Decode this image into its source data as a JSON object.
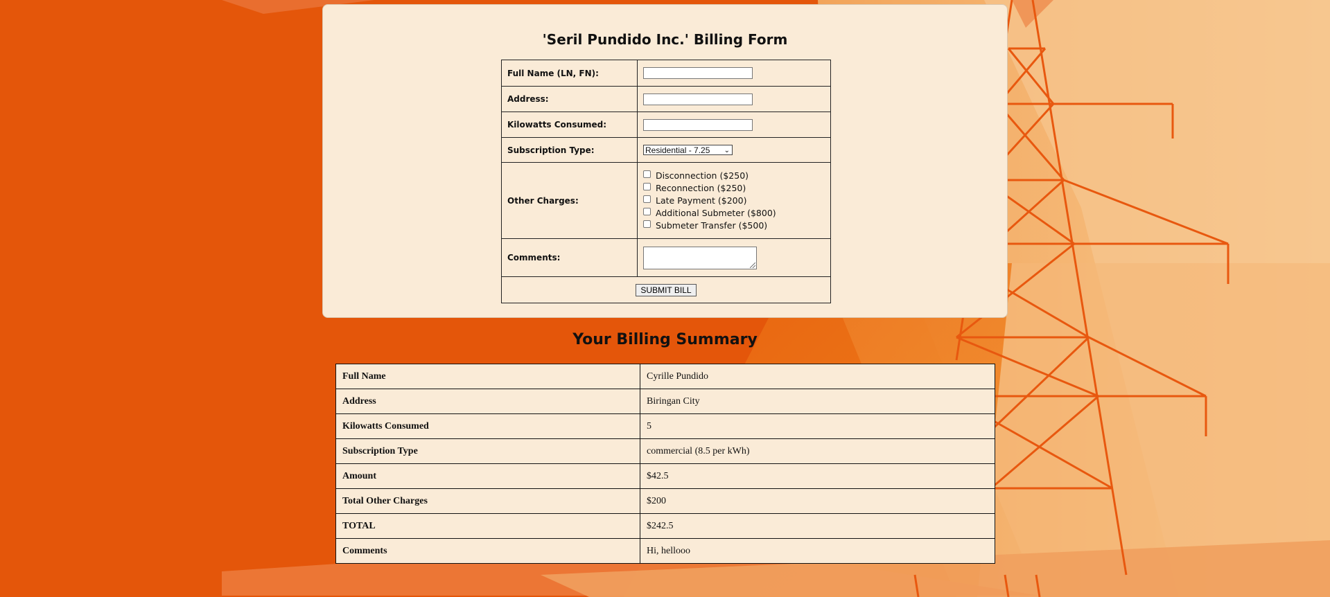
{
  "form": {
    "title": "'Seril Pundido Inc.' Billing Form",
    "full_name_label": "Full Name (LN, FN):",
    "full_name_value": "",
    "address_label": "Address:",
    "address_value": "",
    "kilowatts_label": "Kilowatts Consumed:",
    "kilowatts_value": "",
    "subscription_label": "Subscription Type:",
    "subscription_selected": "Residential - 7.25",
    "other_charges_label": "Other Charges:",
    "other_charges": [
      {
        "label": "Disconnection ($250)",
        "checked": false
      },
      {
        "label": "Reconnection ($250)",
        "checked": false
      },
      {
        "label": "Late Payment ($200)",
        "checked": false
      },
      {
        "label": "Additional Submeter ($800)",
        "checked": false
      },
      {
        "label": "Submeter Transfer ($500)",
        "checked": false
      }
    ],
    "comments_label": "Comments:",
    "comments_value": "",
    "submit_label": "SUBMIT BILL"
  },
  "summary": {
    "title": "Your Billing Summary",
    "rows": [
      {
        "key": "Full Name",
        "value": "Cyrille Pundido"
      },
      {
        "key": "Address",
        "value": "Biringan City"
      },
      {
        "key": "Kilowatts Consumed",
        "value": "5"
      },
      {
        "key": "Subscription Type",
        "value": "commercial (8.5 per kWh)"
      },
      {
        "key": "Amount",
        "value": "$42.5"
      },
      {
        "key": "Total Other Charges",
        "value": "$200"
      },
      {
        "key": "TOTAL",
        "value": "$242.5"
      },
      {
        "key": "Comments",
        "value": "Hi, hellooo"
      }
    ]
  },
  "colors": {
    "background_orange": "#e4560a",
    "panel_beige": "#faebd7",
    "tower_orange": "#e8580f"
  }
}
